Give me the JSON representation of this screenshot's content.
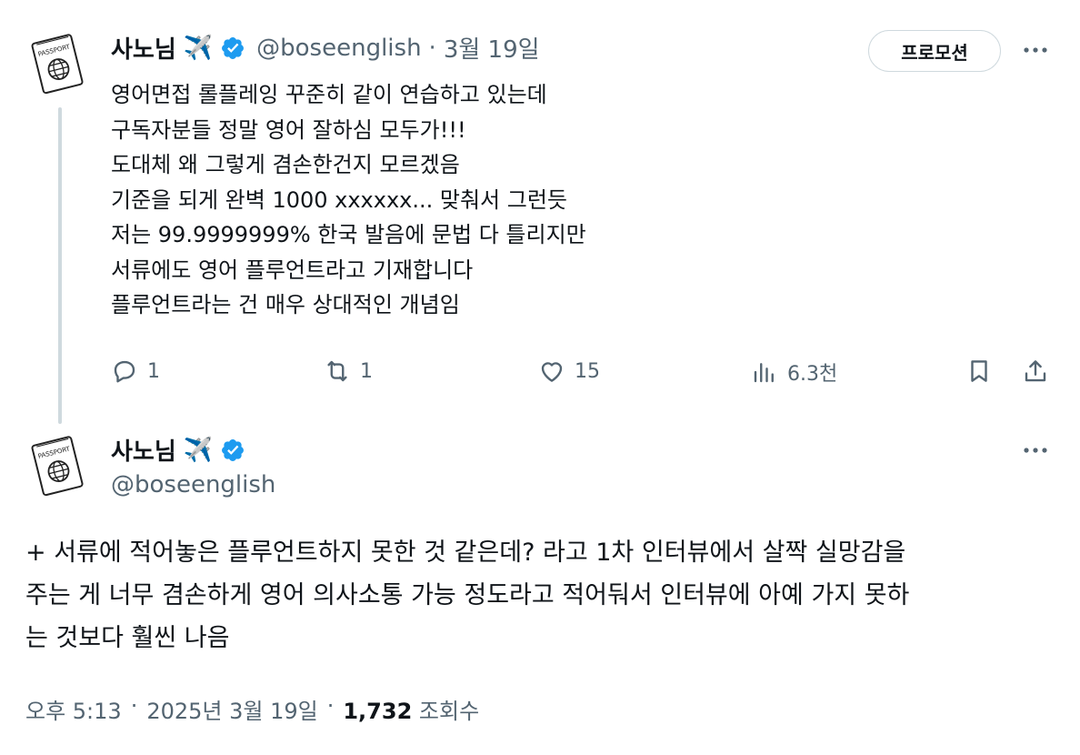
{
  "tweet1": {
    "display_name": "사노님",
    "name_emoji": "✈️",
    "handle": "@boseenglish",
    "separator": "·",
    "date": "3월 19일",
    "promote_label": "프로모션",
    "lines": [
      "영어면접 롤플레잉 꾸준히 같이 연습하고 있는데",
      "구독자분들 정말 영어 잘하심 모두가!!!",
      "도대체 왜 그렇게 겸손한건지 모르겠음",
      "기준을 되게 완벽 1000 xxxxxx... 맞춰서 그런듯",
      "저는 99.9999999% 한국 발음에 문법 다 틀리지만",
      "서류에도 영어 플루언트라고 기재합니다",
      "플루언트라는 건 매우 상대적인 개념임"
    ],
    "actions": {
      "replies": "1",
      "reposts": "1",
      "likes": "15",
      "views": "6.3천"
    }
  },
  "tweet2": {
    "display_name": "사노님",
    "name_emoji": "✈️",
    "handle": "@boseenglish",
    "lines": [
      "+ 서류에 적어놓은 플루언트하지 못한 것 같은데? 라고 1차 인터뷰에서 살짝 실망감을",
      "주는 게 너무 겸손하게 영어 의사소통 가능 정도라고 적어둬서 인터뷰에 아예 가지 못하",
      "는 것보다 훨씬 나음"
    ],
    "time": "오후 5:13",
    "sep1": "·",
    "date": "2025년 3월 19일",
    "sep2": "·",
    "views_count": "1,732",
    "views_label": "조회수"
  },
  "colors": {
    "verified": "#1d9bf0",
    "muted": "#536471",
    "text": "#0f1419",
    "thread_line": "#cfd9de"
  },
  "avatar_label": "PASSPORT"
}
